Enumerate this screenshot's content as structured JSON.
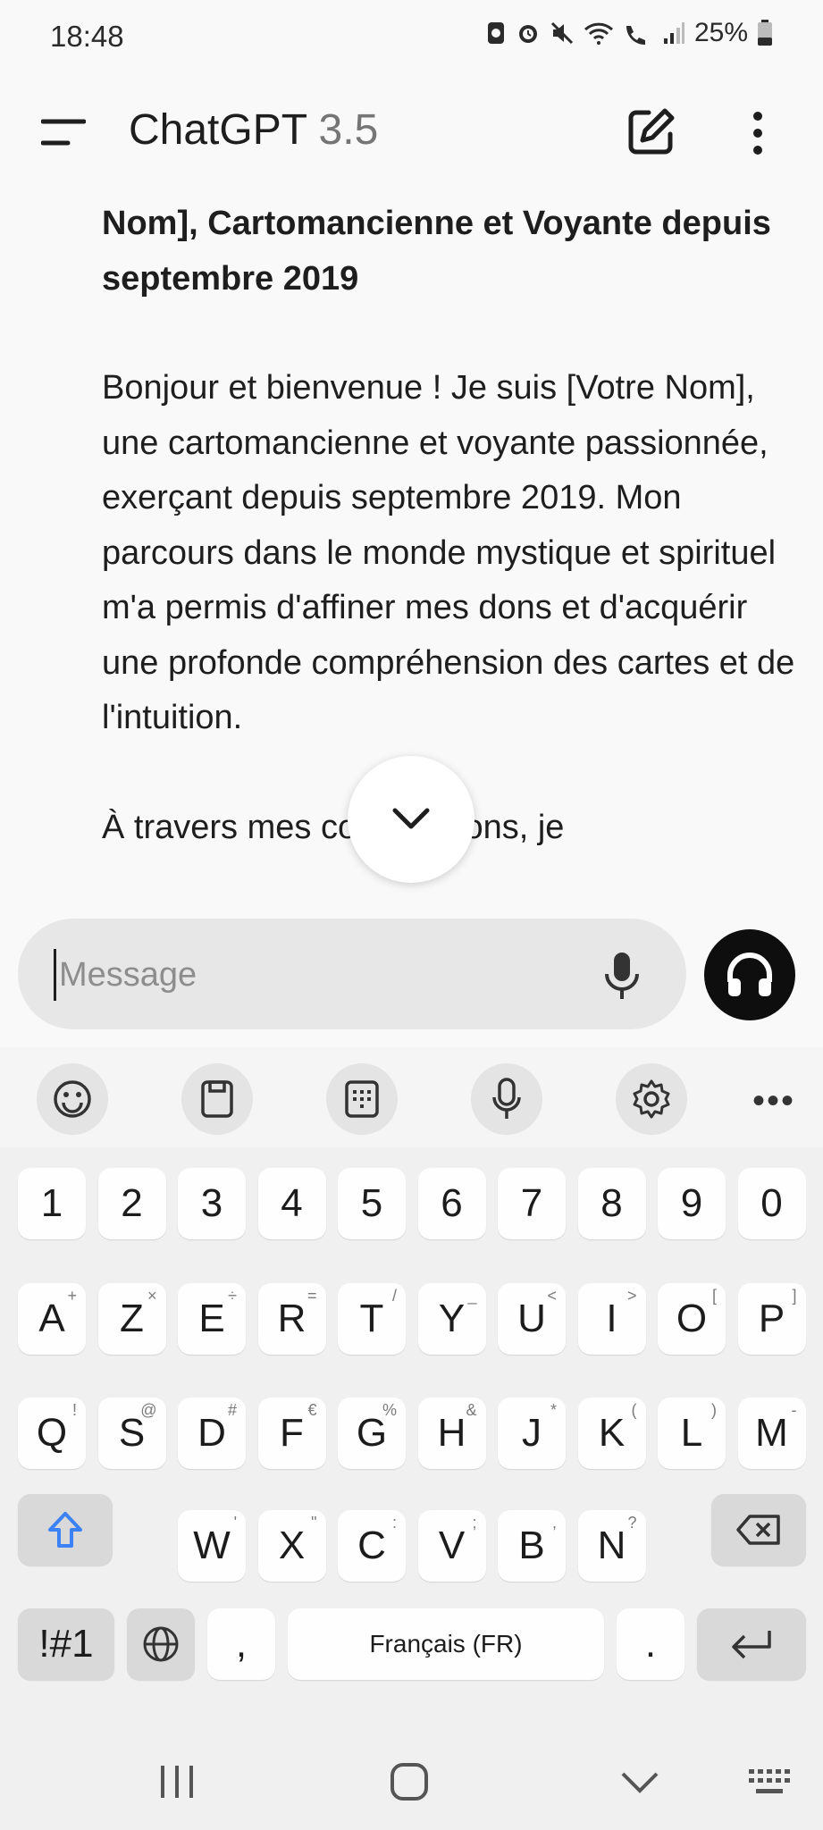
{
  "status_bar": {
    "time": "18:48",
    "battery": "25%",
    "icons": [
      "sim-icon",
      "alarm-icon",
      "mute-icon",
      "wifi-icon",
      "wifi-call-icon",
      "signal-icon",
      "battery-icon"
    ]
  },
  "app_bar": {
    "title": "ChatGPT",
    "version": "3.5",
    "icons": [
      "menu-icon",
      "new-chat-icon",
      "more-vert-icon"
    ]
  },
  "conversation": {
    "heading": "Nom], Cartomancienne et Voyante depuis septembre 2019",
    "paragraph1": "Bonjour et bienvenue ! Je suis [Votre Nom], une cartomancienne et voyante passionnée, exerçant depuis septembre 2019. Mon parcours dans le monde mystique et spirituel m'a permis d'affiner mes dons et d'acquérir une profonde compréhension des cartes et de l'intuition.",
    "paragraph2_partial": "À travers mes consultations, je"
  },
  "composer": {
    "placeholder": "Message",
    "icons": [
      "mic-icon",
      "headphones-icon"
    ]
  },
  "keyboard": {
    "toolbar_icons": [
      "emoji-icon",
      "clipboard-icon",
      "keypad-icon",
      "voice-input-icon",
      "settings-icon",
      "more-icon"
    ],
    "row_numbers": [
      "1",
      "2",
      "3",
      "4",
      "5",
      "6",
      "7",
      "8",
      "9",
      "0"
    ],
    "row1": [
      [
        "A",
        "+"
      ],
      [
        "Z",
        "×"
      ],
      [
        "E",
        "÷"
      ],
      [
        "R",
        "="
      ],
      [
        "T",
        "/"
      ],
      [
        "Y",
        "_"
      ],
      [
        "U",
        "<"
      ],
      [
        "I",
        ">"
      ],
      [
        "O",
        "["
      ],
      [
        "P",
        "]"
      ]
    ],
    "row2": [
      [
        "Q",
        "!"
      ],
      [
        "S",
        "@"
      ],
      [
        "D",
        "#"
      ],
      [
        "F",
        "€"
      ],
      [
        "G",
        "%"
      ],
      [
        "H",
        "&"
      ],
      [
        "J",
        "*"
      ],
      [
        "K",
        "("
      ],
      [
        "L",
        ")"
      ],
      [
        "M",
        "-"
      ]
    ],
    "row3": [
      [
        "W",
        "'"
      ],
      [
        "X",
        "\""
      ],
      [
        "C",
        ":"
      ],
      [
        "V",
        ";"
      ],
      [
        "B",
        ","
      ],
      [
        "N",
        "?"
      ]
    ],
    "symbols_key": "!#1",
    "comma_key": ",",
    "space_label": "Français (FR)",
    "period_key": "."
  },
  "nav_bar": {
    "icons": [
      "recents-icon",
      "home-icon",
      "back-icon",
      "keyboard-hide-icon"
    ]
  },
  "colors": {
    "background": "#f9f9f9",
    "keyboard": "#f0f0f0",
    "accent_shift": "#3b82f6",
    "voice_button": "#0e0e0e"
  }
}
